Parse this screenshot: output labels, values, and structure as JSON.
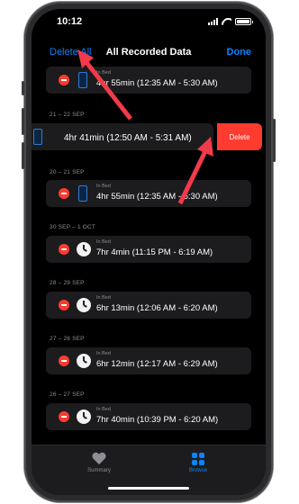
{
  "status_bar": {
    "time": "10:12"
  },
  "nav": {
    "left_button": "Delete All",
    "title": "All Recorded Data",
    "right_button": "Done"
  },
  "sections": [
    {
      "header": "",
      "rows": [
        {
          "label": "In Bed",
          "value": "4hr 55min (12:35 AM - 5:30 AM)",
          "icon": "phone-icon"
        }
      ]
    },
    {
      "header": "21 – 22 SEP",
      "rows": [
        {
          "label": "",
          "value": "4hr 41min (12:50 AM - 5:31 AM)",
          "icon": "phone-icon",
          "swiped": true
        }
      ]
    },
    {
      "header": "20 – 21 SEP",
      "rows": [
        {
          "label": "In Bed",
          "value": "4hr 55min (12:35 AM - 5:30 AM)",
          "icon": "phone-icon"
        }
      ]
    },
    {
      "header": "30 SEP – 1 OCT",
      "rows": [
        {
          "label": "In Bed",
          "value": "7hr 4min (11:15 PM - 6:19 AM)",
          "icon": "clock-icon"
        }
      ]
    },
    {
      "header": "28 – 29 SEP",
      "rows": [
        {
          "label": "In Bed",
          "value": "6hr 13min (12:06 AM - 6:20 AM)",
          "icon": "clock-icon"
        }
      ]
    },
    {
      "header": "27 – 28 SEP",
      "rows": [
        {
          "label": "In Bed",
          "value": "6hr 12min (12:17 AM - 6:29 AM)",
          "icon": "clock-icon"
        }
      ]
    },
    {
      "header": "26 – 27 SEP",
      "rows": [
        {
          "label": "In Bed",
          "value": "7hr 40min (10:39 PM - 6:20 AM)",
          "icon": "clock-icon"
        }
      ]
    }
  ],
  "delete_button": "Delete",
  "tabbar": {
    "summary": "Summary",
    "browse": "Browse"
  },
  "colors": {
    "accent": "#0a84ff",
    "destructive": "#ff3b30",
    "annotation_arrow": "#f23a4a"
  }
}
